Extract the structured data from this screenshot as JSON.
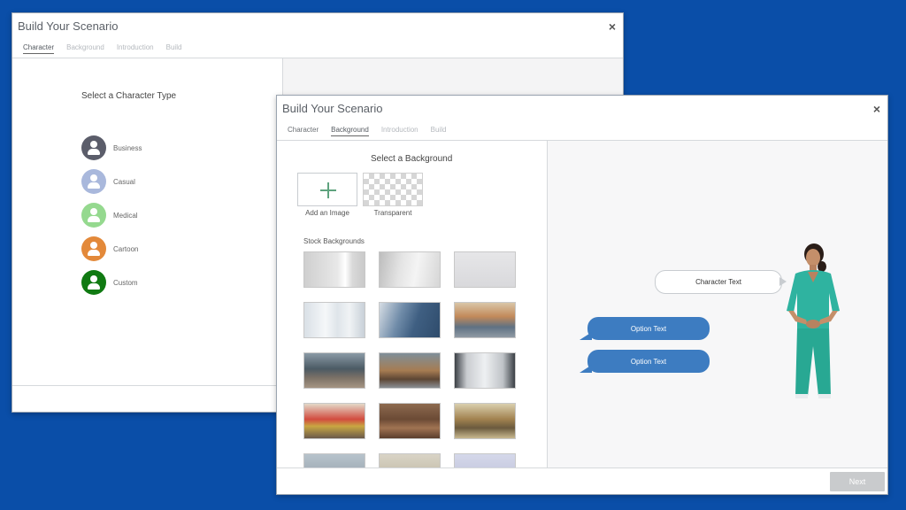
{
  "back_dialog": {
    "title": "Build Your Scenario",
    "close": "×",
    "tabs": [
      "Character",
      "Background",
      "Introduction",
      "Build"
    ],
    "active_tab": "Character",
    "heading": "Select a Character Type",
    "character_types": [
      {
        "label": "Business",
        "color": "#5b5d6a"
      },
      {
        "label": "Casual",
        "color": "#a9b8dc"
      },
      {
        "label": "Medical",
        "color": "#95d98f"
      },
      {
        "label": "Cartoon",
        "color": "#e3893a"
      },
      {
        "label": "Custom",
        "color": "#107a12"
      }
    ]
  },
  "front_dialog": {
    "title": "Build Your Scenario",
    "close": "×",
    "tabs": [
      "Character",
      "Background",
      "Introduction",
      "Build"
    ],
    "active_tab": "Background",
    "heading": "Select a Background",
    "options": {
      "add_image": "Add an Image",
      "transparent": "Transparent"
    },
    "stock_heading": "Stock Backgrounds",
    "preview": {
      "character_text": "Character Text",
      "option_texts": [
        "Option Text",
        "Option Text"
      ]
    },
    "next_label": "Next"
  },
  "colors": {
    "desktop": "#0a4ea8",
    "option_bubble": "#3d7cc1",
    "add_plus": "#5ea37e",
    "scrubs": "#2fb3a0"
  },
  "icons": {
    "close": "close-icon",
    "add": "plus-icon",
    "avatar": "person-icon"
  }
}
